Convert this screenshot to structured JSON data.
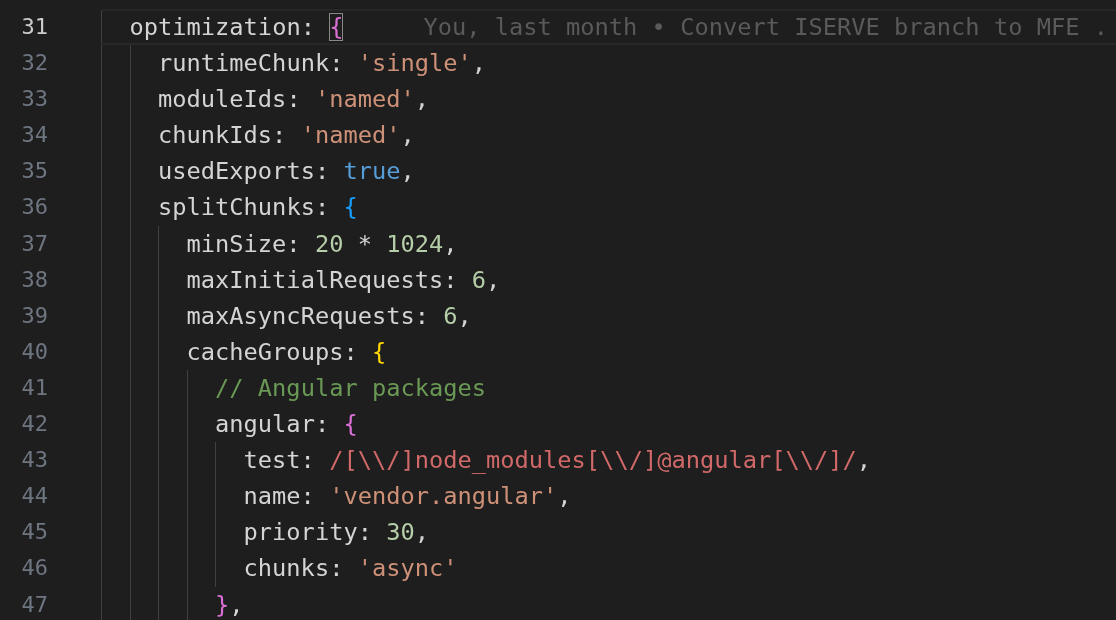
{
  "editor": {
    "lines": [
      {
        "number": "31",
        "current": true,
        "tokens": [
          {
            "kind": "key",
            "text": "optimization: "
          },
          {
            "kind": "bracket2",
            "text": "{",
            "matched": true
          }
        ],
        "blame": "You, last month • Convert ISERVE branch to MFE .",
        "children": [
          {
            "number": "32",
            "current": false,
            "tokens": [
              {
                "kind": "key",
                "text": "runtimeChunk: "
              },
              {
                "kind": "string",
                "text": "'single'"
              },
              {
                "kind": "punct",
                "text": ","
              }
            ]
          },
          {
            "number": "33",
            "current": false,
            "tokens": [
              {
                "kind": "key",
                "text": "moduleIds: "
              },
              {
                "kind": "string",
                "text": "'named'"
              },
              {
                "kind": "punct",
                "text": ","
              }
            ]
          },
          {
            "number": "34",
            "current": false,
            "tokens": [
              {
                "kind": "key",
                "text": "chunkIds: "
              },
              {
                "kind": "string",
                "text": "'named'"
              },
              {
                "kind": "punct",
                "text": ","
              }
            ]
          },
          {
            "number": "35",
            "current": false,
            "tokens": [
              {
                "kind": "key",
                "text": "usedExports: "
              },
              {
                "kind": "keyword",
                "text": "true"
              },
              {
                "kind": "punct",
                "text": ","
              }
            ]
          },
          {
            "number": "36",
            "current": false,
            "tokens": [
              {
                "kind": "key",
                "text": "splitChunks: "
              },
              {
                "kind": "bracket3",
                "text": "{",
                "matched": false
              }
            ],
            "children": [
              {
                "number": "37",
                "current": false,
                "tokens": [
                  {
                    "kind": "key",
                    "text": "minSize: "
                  },
                  {
                    "kind": "number",
                    "text": "20"
                  },
                  {
                    "kind": "punct",
                    "text": " * "
                  },
                  {
                    "kind": "number",
                    "text": "1024"
                  },
                  {
                    "kind": "punct",
                    "text": ","
                  }
                ]
              },
              {
                "number": "38",
                "current": false,
                "tokens": [
                  {
                    "kind": "key",
                    "text": "maxInitialRequests: "
                  },
                  {
                    "kind": "number",
                    "text": "6"
                  },
                  {
                    "kind": "punct",
                    "text": ","
                  }
                ]
              },
              {
                "number": "39",
                "current": false,
                "tokens": [
                  {
                    "kind": "key",
                    "text": "maxAsyncRequests: "
                  },
                  {
                    "kind": "number",
                    "text": "6"
                  },
                  {
                    "kind": "punct",
                    "text": ","
                  }
                ]
              },
              {
                "number": "40",
                "current": false,
                "tokens": [
                  {
                    "kind": "key",
                    "text": "cacheGroups: "
                  },
                  {
                    "kind": "bracket1",
                    "text": "{",
                    "matched": false
                  }
                ],
                "children": [
                  {
                    "number": "41",
                    "current": false,
                    "tokens": [
                      {
                        "kind": "comment",
                        "text": "// Angular packages"
                      }
                    ]
                  },
                  {
                    "number": "42",
                    "current": false,
                    "tokens": [
                      {
                        "kind": "key",
                        "text": "angular: "
                      },
                      {
                        "kind": "bracket2",
                        "text": "{",
                        "matched": false
                      }
                    ],
                    "children": [
                      {
                        "number": "43",
                        "current": false,
                        "tokens": [
                          {
                            "kind": "key",
                            "text": "test: "
                          },
                          {
                            "kind": "regex",
                            "text": "/[\\\\/]node_modules[\\\\/]@angular[\\\\/]/"
                          },
                          {
                            "kind": "punct",
                            "text": ","
                          }
                        ]
                      },
                      {
                        "number": "44",
                        "current": false,
                        "tokens": [
                          {
                            "kind": "key",
                            "text": "name: "
                          },
                          {
                            "kind": "string",
                            "text": "'vendor.angular'"
                          },
                          {
                            "kind": "punct",
                            "text": ","
                          }
                        ]
                      },
                      {
                        "number": "45",
                        "current": false,
                        "tokens": [
                          {
                            "kind": "key",
                            "text": "priority: "
                          },
                          {
                            "kind": "number",
                            "text": "30"
                          },
                          {
                            "kind": "punct",
                            "text": ","
                          }
                        ]
                      },
                      {
                        "number": "46",
                        "current": false,
                        "tokens": [
                          {
                            "kind": "key",
                            "text": "chunks: "
                          },
                          {
                            "kind": "string",
                            "text": "'async'"
                          }
                        ]
                      }
                    ]
                  },
                  {
                    "number": "47",
                    "current": false,
                    "tokens": [
                      {
                        "kind": "bracket2",
                        "text": "}",
                        "matched": false
                      },
                      {
                        "kind": "punct",
                        "text": ","
                      }
                    ]
                  }
                ]
              }
            ]
          }
        ]
      }
    ]
  }
}
